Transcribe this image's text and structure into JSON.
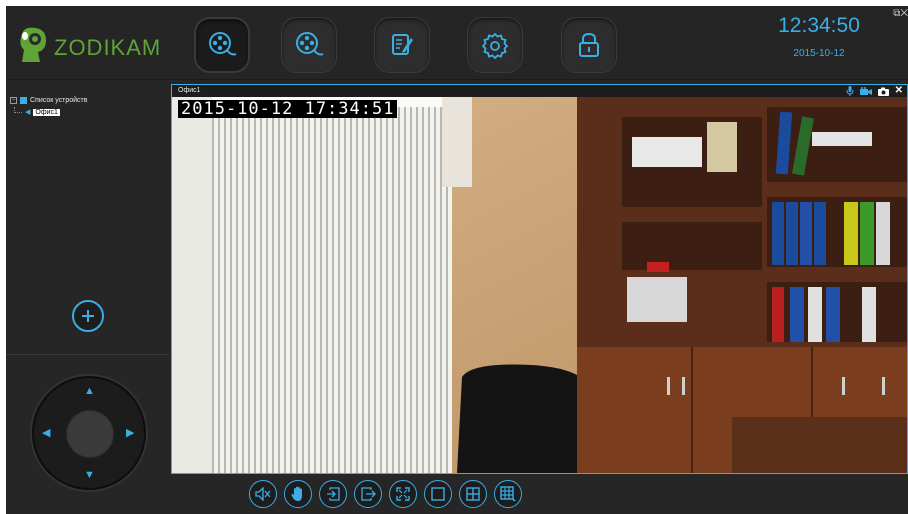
{
  "brand": {
    "name": "ZODIKAM",
    "color": "#5ea437"
  },
  "accent": "#3aaee6",
  "nav": [
    {
      "name": "live-view",
      "icon": "film-reel-icon"
    },
    {
      "name": "playback",
      "icon": "film-reel-icon"
    },
    {
      "name": "log",
      "icon": "edit-document-icon"
    },
    {
      "name": "settings",
      "icon": "gear-icon"
    },
    {
      "name": "lock",
      "icon": "lock-icon"
    }
  ],
  "clock": {
    "time": "12:34:50",
    "date": "2015-10-12"
  },
  "device_tree": {
    "root_label": "Список устройств",
    "device_label": "Офис1"
  },
  "video": {
    "title": "Офис1",
    "osd": "2015-10-12   17:34:51",
    "tools": [
      "microphone-icon",
      "video-record-icon",
      "snapshot-camera-icon",
      "close-icon"
    ]
  },
  "toolbar": [
    "mute-icon",
    "hand-stop-icon",
    "import-icon",
    "export-icon",
    "fullscreen-icon",
    "layout-1-icon",
    "layout-4-icon",
    "layout-9-icon"
  ]
}
